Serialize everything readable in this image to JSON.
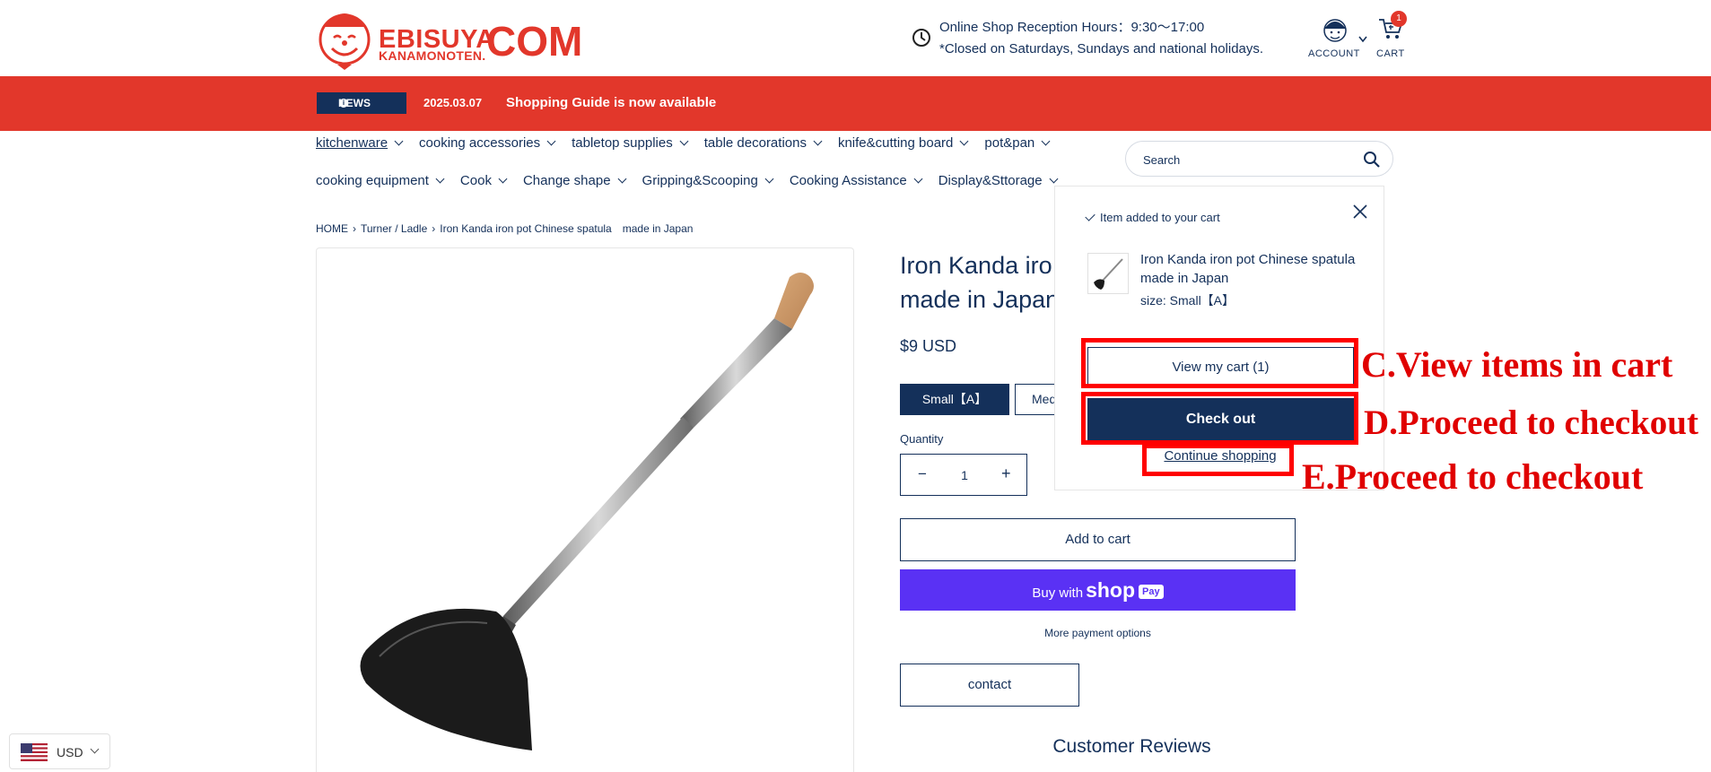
{
  "header": {
    "logo_line1": "EBISUYA",
    "logo_line2": "KANAMONOTEN.",
    "logo_com": "COM",
    "hours_line1": "Online Shop Reception Hours：9:30〜17:00",
    "hours_line2": "*Closed on Saturdays, Sundays and national holidays.",
    "account_label": "ACCOUNT",
    "cart_label": "CART",
    "cart_count": "1",
    "brand_color": "#e2372b",
    "navy_color": "#14305a"
  },
  "news": {
    "tag": "NEWS",
    "date": "2025.03.07",
    "text": "Shopping Guide is now available"
  },
  "nav": {
    "row1": [
      "kitchenware",
      "cooking accessories",
      "tabletop supplies",
      "table decorations",
      "knife&cutting board",
      "pot&pan"
    ],
    "row2": [
      "cooking equipment",
      "Cook",
      "Change shape",
      "Gripping&Scooping",
      "Cooking Assistance",
      "Display&Sttorage"
    ]
  },
  "search": {
    "placeholder": "Search"
  },
  "breadcrumb": [
    "HOME",
    "Turner / Ladle",
    "Iron Kanda iron pot Chinese spatula　made in Japan"
  ],
  "product": {
    "title_line1": "Iron Kanda iro",
    "title_line2": "made in Japan",
    "price": "$9 USD",
    "size_selected": "Small【A】",
    "size_other": "Med",
    "quantity_label": "Quantity",
    "quantity": "1",
    "minus": "−",
    "plus": "+",
    "add_to_cart": "Add to cart",
    "buy_with": "Buy with",
    "shop_brand": "shop",
    "pay_badge": "Pay",
    "more_payment": "More payment options",
    "contact": "contact",
    "reviews_heading": "Customer Reviews"
  },
  "cart_popup": {
    "added_text": "Item added to your cart",
    "item_name": "Iron Kanda iron pot Chinese spatula　made in Japan",
    "item_size": "size: Small【A】",
    "view_cart": "View my cart (1)",
    "checkout": "Check out",
    "continue": "Continue shopping"
  },
  "annotations": {
    "c": "C.View items in cart",
    "d": "D.Proceed to checkout",
    "e": "E.Proceed to checkout",
    "color": "#ff0000"
  },
  "currency": {
    "code": "USD",
    "flag": "us-flag-icon"
  }
}
